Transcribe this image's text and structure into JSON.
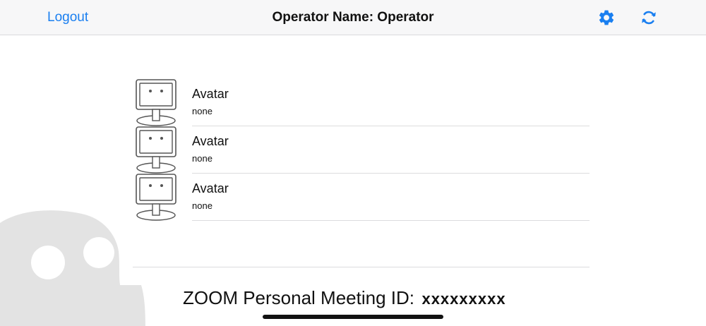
{
  "navbar": {
    "logout_label": "Logout",
    "title": "Operator Name: Operator",
    "settings_icon": "gear-icon",
    "refresh_icon": "refresh-icon",
    "accent_color": "#1a7ff0"
  },
  "avatars": [
    {
      "name": "Avatar",
      "status": "none"
    },
    {
      "name": "Avatar",
      "status": "none"
    },
    {
      "name": "Avatar",
      "status": "none"
    }
  ],
  "meeting": {
    "label": "ZOOM Personal Meeting ID:",
    "id": "xxxxxxxxx"
  }
}
